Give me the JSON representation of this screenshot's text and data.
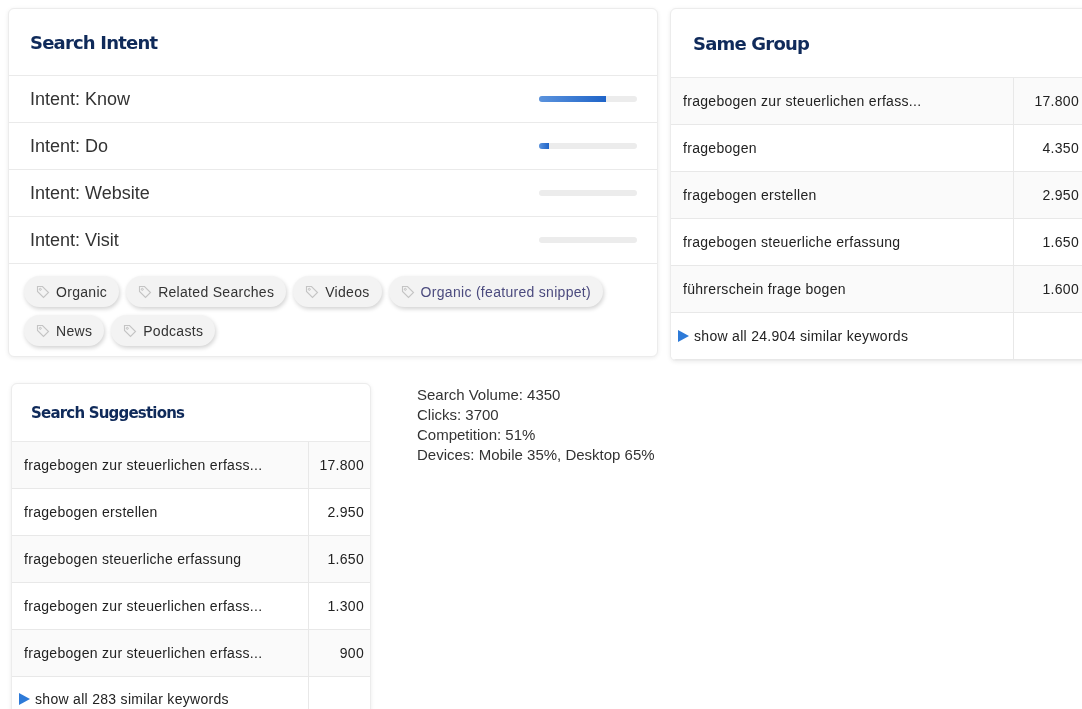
{
  "search_intent": {
    "title": "Search Intent",
    "intents": [
      {
        "label": "Intent: Know",
        "level": 0.68
      },
      {
        "label": "Intent: Do",
        "level": 0.1
      },
      {
        "label": "Intent: Website"
      },
      {
        "label": "Intent: Visit"
      }
    ],
    "tags": [
      {
        "label": "Organic",
        "highlighted": false
      },
      {
        "label": "Related Searches",
        "highlighted": false
      },
      {
        "label": "Videos",
        "highlighted": false
      },
      {
        "label": "Organic (featured snippet)",
        "highlighted": true
      },
      {
        "label": "News",
        "highlighted": false
      },
      {
        "label": "Podcasts",
        "highlighted": false
      }
    ]
  },
  "same_group": {
    "title": "Same Group",
    "rows": [
      {
        "keyword": "fragebogen zur steuerlichen erfass...",
        "volume": "17.800"
      },
      {
        "keyword": "fragebogen",
        "volume": "4.350"
      },
      {
        "keyword": "fragebogen erstellen",
        "volume": "2.950"
      },
      {
        "keyword": "fragebogen steuerliche erfassung",
        "volume": "1.650"
      },
      {
        "keyword": "führerschein frage bogen",
        "volume": "1.600"
      }
    ],
    "show_all": "show all 24.904 similar keywords"
  },
  "search_suggestions": {
    "title": "Search Suggestions",
    "rows": [
      {
        "keyword": "fragebogen zur steuerlichen erfass...",
        "volume": "17.800"
      },
      {
        "keyword": "fragebogen erstellen",
        "volume": "2.950"
      },
      {
        "keyword": "fragebogen steuerliche erfassung",
        "volume": "1.650"
      },
      {
        "keyword": "fragebogen zur steuerlichen erfass...",
        "volume": "1.300"
      },
      {
        "keyword": "fragebogen zur steuerlichen erfass...",
        "volume": "900"
      }
    ],
    "show_all": "show all 283 similar keywords"
  },
  "stats": [
    "Search Volume: 4350",
    "Clicks: 3700",
    "Competition: 51%",
    "Devices: Mobile 35%, Desktop 65%"
  ]
}
